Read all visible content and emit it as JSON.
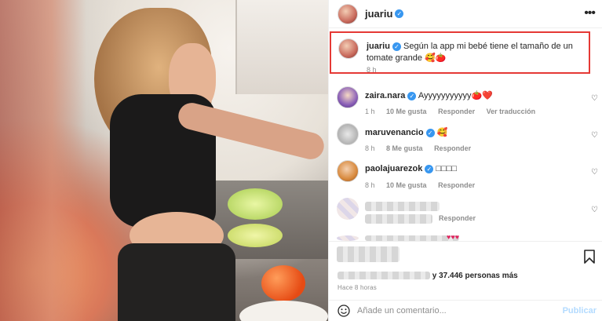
{
  "post": {
    "username": "juariu",
    "caption_text": "Según la app mi bebé tiene el tamaño de un tomate grande 🥰🍅",
    "caption_time": "8 h"
  },
  "comments": [
    {
      "user": "zaira.nara",
      "text": "Ayyyyyyyyyyy🍅❤️",
      "time": "1 h",
      "likes": "10 Me gusta",
      "reply": "Responder",
      "translate": "Ver traducción"
    },
    {
      "user": "maruvenancio",
      "text": "🥰",
      "time": "8 h",
      "likes": "8 Me gusta",
      "reply": "Responder"
    },
    {
      "user": "paolajuarezok",
      "text": "□□□□",
      "time": "8 h",
      "likes": "10 Me gusta",
      "reply": "Responder"
    },
    {
      "reply": "Responder"
    }
  ],
  "likes_suffix": "y 37.446 personas más",
  "time_ago": "Hace 8 horas",
  "composer": {
    "placeholder": "Añade un comentario...",
    "publish": "Publicar"
  },
  "icons": {
    "more": "more-options-icon",
    "bookmark": "bookmark-icon",
    "emoji": "emoji-icon",
    "heart": "heart-outline-icon",
    "verified": "verified-badge-icon"
  },
  "colors": {
    "accent_blue": "#3897f0",
    "highlight_border": "#e53935",
    "publish_disabled": "#b3dbff"
  }
}
